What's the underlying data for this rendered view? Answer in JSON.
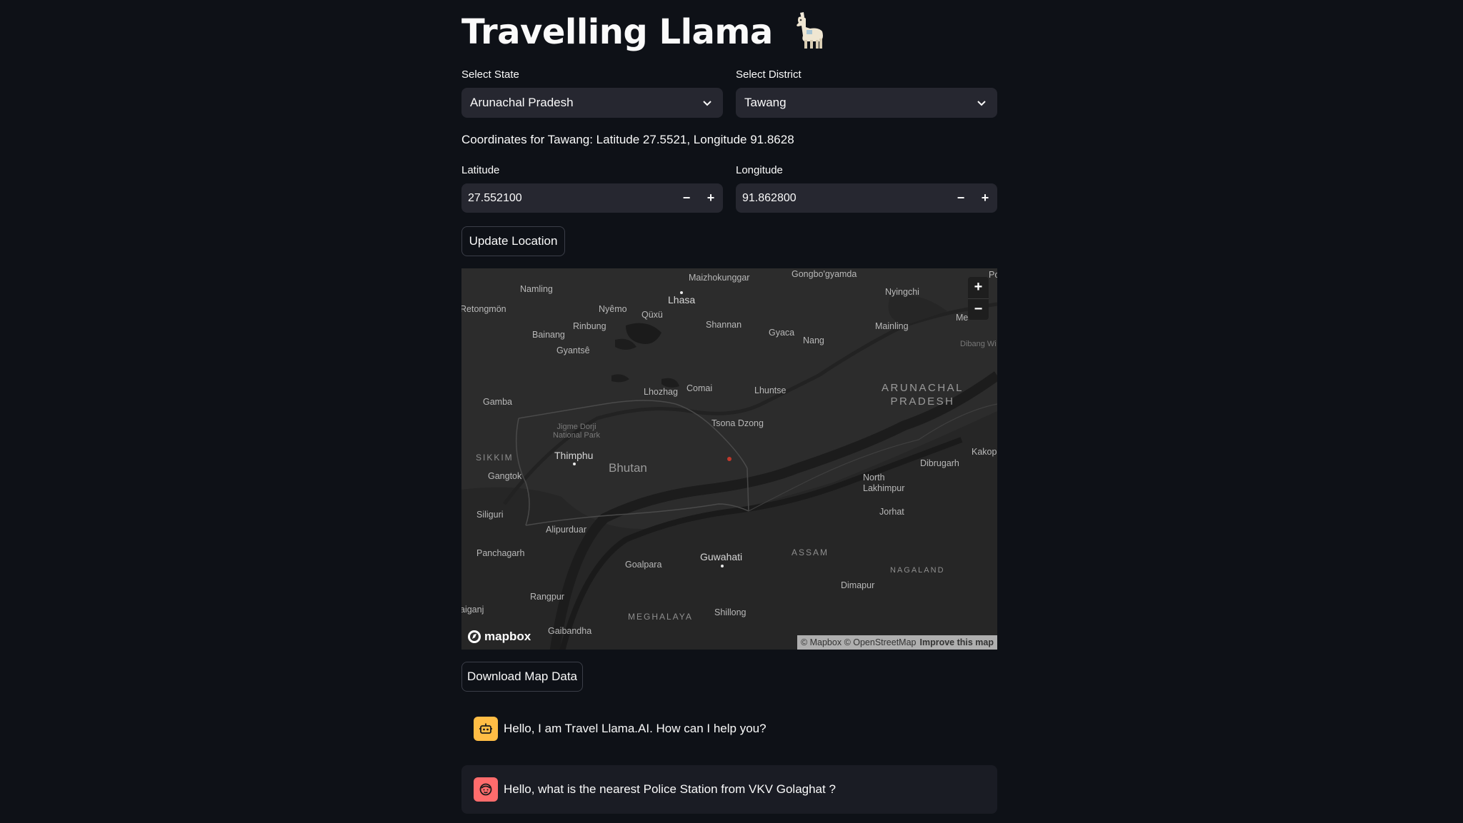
{
  "title": "Travelling Llama",
  "title_icon": "llama-emoji",
  "state_select": {
    "label": "Select State",
    "value": "Arunachal Pradesh"
  },
  "district_select": {
    "label": "Select District",
    "value": "Tawang"
  },
  "coords_text": "Coordinates for Tawang: Latitude 27.5521, Longitude 91.8628",
  "latitude": {
    "label": "Latitude",
    "value": "27.552100"
  },
  "longitude": {
    "label": "Longitude",
    "value": "91.862800"
  },
  "update_button": "Update Location",
  "map": {
    "places": {
      "maizhokunggar": "Maizhokunggar",
      "gongbogyamda": "Gongbo'gyamda",
      "namling": "Namling",
      "lhasa": "Lhasa",
      "nyingchi": "Nyingchi",
      "po": "Po",
      "rentongmon": "Retongmön",
      "nyemo": "Nyêmo",
      "quxu": "Qüxü",
      "bainang": "Bainang",
      "rinbung": "Rinbung",
      "shannan": "Shannan",
      "gyaca": "Gyaca",
      "mainling": "Mainling",
      "me": "Me",
      "nang": "Nang",
      "gyantse": "Gyantsê",
      "dibang": "Dibang Wi",
      "arunachal": "ARUNACHAL\nPRADESH",
      "lhozhag": "Lhozhag",
      "comai": "Comai",
      "lhuntse": "Lhuntse",
      "gamba": "Gamba",
      "jigme": "Jigme Dorji\nNational Park",
      "tsona": "Tsona Dzong",
      "sikkim": "SIKKIM",
      "thimphu": "Thimphu",
      "bhutan": "Bhutan",
      "dibrugarh": "Dibrugarh",
      "kakopa": "Kakopa",
      "gangtok": "Gangtok",
      "north_lakhimpur": "North\nLakhimpur",
      "jorhat": "Jorhat",
      "siliguri": "Siliguri",
      "alipurduar": "Alipurduar",
      "panchagarh": "Panchagarh",
      "assam": "ASSAM",
      "goalpara": "Goalpara",
      "guwahati": "Guwahati",
      "nagaland": "NAGALAND",
      "dimapur": "Dimapur",
      "rangpur": "Rangpur",
      "aiganj": "aiganj",
      "meghalaya": "MEGHALAYA",
      "shillong": "Shillong",
      "gaibandha": "Gaibandha"
    },
    "logo_text": "mapbox",
    "attribution": "© Mapbox © OpenStreetMap",
    "improve_link": "Improve this map",
    "zoom_in": "+",
    "zoom_out": "−",
    "marker_color": "#c0392b"
  },
  "download_button": "Download Map Data",
  "chat": [
    {
      "role": "assistant",
      "avatar_icon": "robot-icon",
      "avatar_color": "#ffbd45",
      "text": "Hello, I am Travel Llama.AI. How can I help you?"
    },
    {
      "role": "user",
      "avatar_icon": "face-icon",
      "avatar_color": "#ff6c6c",
      "text": "Hello, what is the nearest Police Station from VKV Golaghat ?"
    }
  ]
}
